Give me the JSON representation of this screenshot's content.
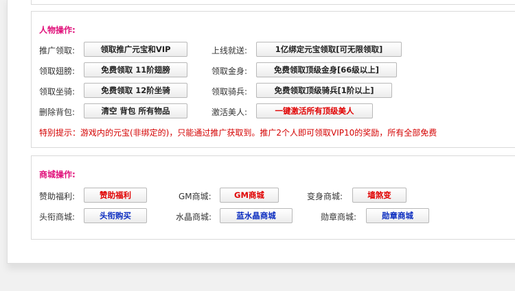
{
  "person_section": {
    "title": "人物操作:",
    "rows": [
      {
        "left_label": "推广领取:",
        "left_button": "领取推广元宝和VIP",
        "right_label": "上线就送:",
        "right_button": "1亿绑定元宝领取[可无限领取]"
      },
      {
        "left_label": "领取翅膀:",
        "left_button": "免费领取 11阶翅膀",
        "right_label": "领取金身:",
        "right_button": "免费领取顶级金身[66级以上]"
      },
      {
        "left_label": "领取坐骑:",
        "left_button": "免费领取 12阶坐骑",
        "right_label": "领取骑兵:",
        "right_button": "免费领取顶级骑兵[1阶以上]"
      },
      {
        "left_label": "删除背包:",
        "left_button": "清空 背包 所有物品",
        "right_label": "激活美人:",
        "right_button": "一键激活所有顶级美人"
      }
    ],
    "notice": "特别提示：游戏内的元宝(非绑定的)，只能通过推广获取到。推广2个人即可领取VIP10的奖励，所有全部免费"
  },
  "shop_section": {
    "title": "商城操作:",
    "row1": [
      {
        "label": "赞助福利:",
        "button": "赞助福利"
      },
      {
        "label": "GM商城:",
        "button": "GM商城"
      },
      {
        "label": "变身商城:",
        "button": "墙煞变"
      }
    ],
    "row2": [
      {
        "label": "头衔商城:",
        "button": "头衔购买"
      },
      {
        "label": "水晶商城:",
        "button": "蓝水晶商城"
      },
      {
        "label": "勋章商城:",
        "button": "勋章商城"
      }
    ]
  },
  "colors": {
    "title": "#e0107a",
    "red_text": "#e00000",
    "blue_text": "#0a2cc0",
    "notice": "#d40000"
  }
}
